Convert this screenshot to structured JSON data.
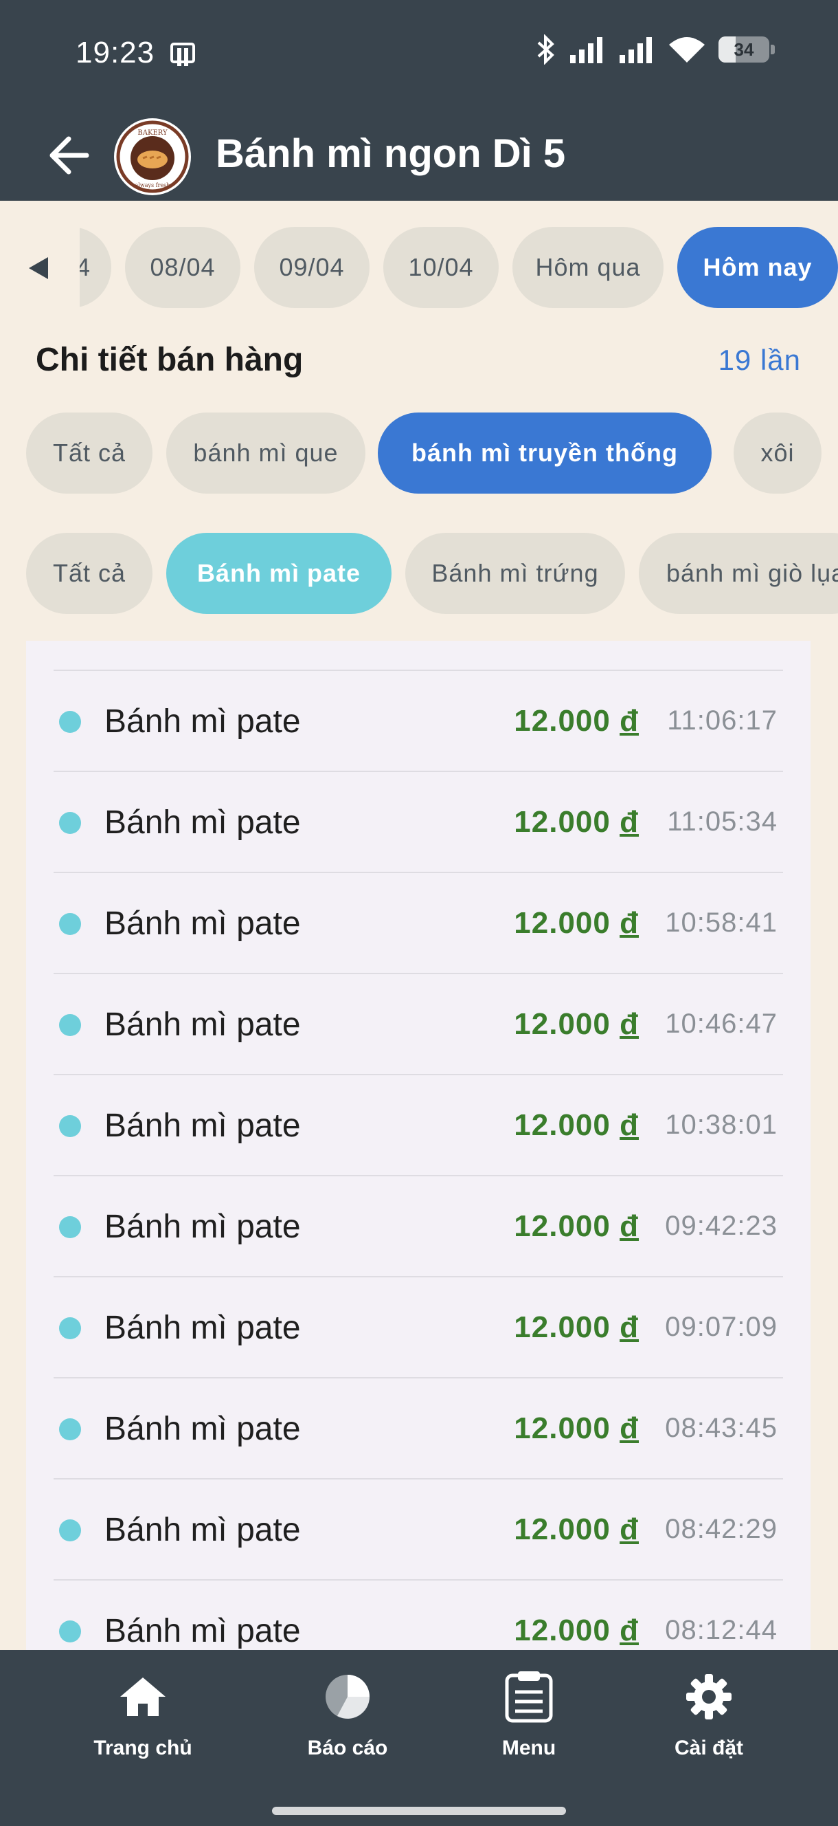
{
  "status_bar": {
    "time": "19:23",
    "battery": "34"
  },
  "app_bar": {
    "title": "Bánh mì ngon Dì 5",
    "logo_text_top": "BAKERY",
    "logo_text_bottom": "always fresh"
  },
  "date_chips": [
    {
      "label": "4",
      "active": false
    },
    {
      "label": "08/04",
      "active": false
    },
    {
      "label": "09/04",
      "active": false
    },
    {
      "label": "10/04",
      "active": false
    },
    {
      "label": "Hôm qua",
      "active": false
    },
    {
      "label": "Hôm nay",
      "active": true
    }
  ],
  "section": {
    "title": "Chi tiết bán hàng",
    "count": "19 lần"
  },
  "categories": [
    {
      "label": "Tất cả",
      "active": false
    },
    {
      "label": "bánh mì que",
      "active": false
    },
    {
      "label": "bánh mì truyền thống",
      "active": true
    },
    {
      "label": "xôi",
      "active": false
    }
  ],
  "items": [
    {
      "label": "Tất cả",
      "active": false
    },
    {
      "label": "Bánh mì pate",
      "active": true
    },
    {
      "label": "Bánh mì trứng",
      "active": false
    },
    {
      "label": "bánh mì giò lụa",
      "active": false
    }
  ],
  "sales": [
    {
      "name": "Bánh mì pate",
      "price": "12.000",
      "currency": "đ",
      "time": "11:06:17"
    },
    {
      "name": "Bánh mì pate",
      "price": "12.000",
      "currency": "đ",
      "time": "11:05:34"
    },
    {
      "name": "Bánh mì pate",
      "price": "12.000",
      "currency": "đ",
      "time": "10:58:41"
    },
    {
      "name": "Bánh mì pate",
      "price": "12.000",
      "currency": "đ",
      "time": "10:46:47"
    },
    {
      "name": "Bánh mì pate",
      "price": "12.000",
      "currency": "đ",
      "time": "10:38:01"
    },
    {
      "name": "Bánh mì pate",
      "price": "12.000",
      "currency": "đ",
      "time": "09:42:23"
    },
    {
      "name": "Bánh mì pate",
      "price": "12.000",
      "currency": "đ",
      "time": "09:07:09"
    },
    {
      "name": "Bánh mì pate",
      "price": "12.000",
      "currency": "đ",
      "time": "08:43:45"
    },
    {
      "name": "Bánh mì pate",
      "price": "12.000",
      "currency": "đ",
      "time": "08:42:29"
    },
    {
      "name": "Bánh mì pate",
      "price": "12.000",
      "currency": "đ",
      "time": "08:12:44"
    }
  ],
  "bottom_nav": [
    {
      "label": "Trang chủ",
      "icon": "home-icon"
    },
    {
      "label": "Báo cáo",
      "icon": "pie-chart-icon"
    },
    {
      "label": "Menu",
      "icon": "clipboard-icon"
    },
    {
      "label": "Cài đặt",
      "icon": "gear-icon"
    }
  ]
}
